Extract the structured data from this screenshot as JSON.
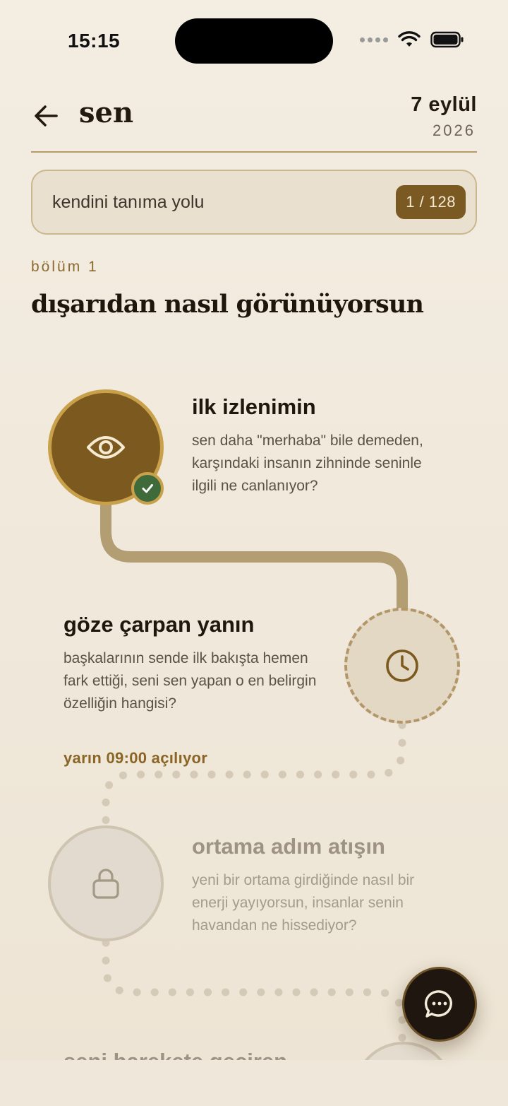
{
  "status_bar": {
    "time": "15:15"
  },
  "header": {
    "title": "sen",
    "date_day": "7 eylül",
    "date_year": "2026"
  },
  "journey": {
    "name": "kendini tanıma yolu",
    "progress": "1 / 128"
  },
  "section": {
    "label": "bölüm 1",
    "title": "dışarıdan nasıl görünüyorsun"
  },
  "steps": [
    {
      "title": "ilk izlenimin",
      "description": "sen daha \"merhaba\" bile demeden, karşındaki insanın zihninde seninle ilgili ne canlanıyor?",
      "state": "completed",
      "icon": "eye-icon"
    },
    {
      "title": "göze çarpan yanın",
      "description": "başkalarının sende ilk bakışta hemen fark ettiği, seni sen yapan o en belirgin özelliğin hangisi?",
      "unlock_text": "yarın 09:00 açılıyor",
      "state": "upcoming",
      "icon": "clock-icon"
    },
    {
      "title": "ortama adım atışın",
      "description": "yeni bir ortama girdiğinde nasıl bir enerji yayıyorsun, insanlar senin havandan ne hissediyor?",
      "state": "locked",
      "icon": "lock-icon"
    },
    {
      "title": "seni harekete geçiren",
      "state": "locked"
    }
  ],
  "colors": {
    "accent": "#7c5a1f",
    "accent_ring": "#c9a14b",
    "completed": "#3f6b3a",
    "background": "#f3ede2",
    "fab": "#1e160f"
  },
  "fab": {
    "icon": "chat-bubble-icon"
  }
}
